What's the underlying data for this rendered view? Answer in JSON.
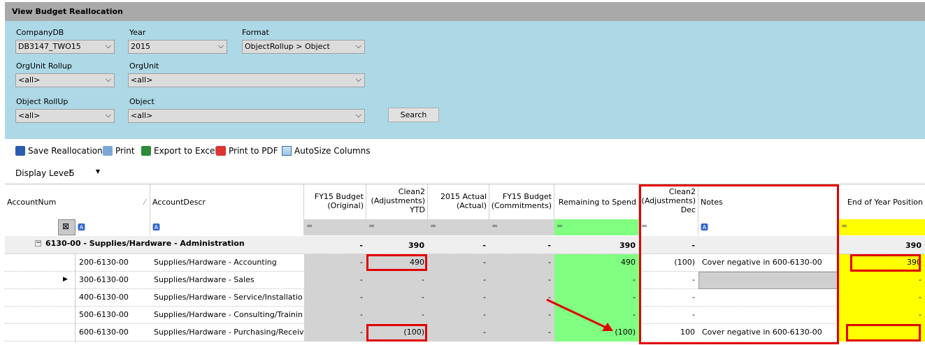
{
  "window": {
    "title": "View Budget Reallocation"
  },
  "filters": {
    "companydb": {
      "label": "CompanyDB",
      "value": "DB3147_TWO15"
    },
    "year": {
      "label": "Year",
      "value": "2015"
    },
    "format": {
      "label": "Format",
      "value": "ObjectRollup > Object"
    },
    "orgunit_rollup": {
      "label": "OrgUnit Rollup",
      "value": "<all>"
    },
    "orgunit": {
      "label": "OrgUnit",
      "value": "<all>"
    },
    "object_rollup": {
      "label": "Object RollUp",
      "value": "<all>"
    },
    "object": {
      "label": "Object",
      "value": "<all>"
    },
    "search_label": "Search"
  },
  "toolbar": {
    "save": "Save Reallocation",
    "print": "Print",
    "export": "Export to Excel",
    "pdf": "Print to PDF",
    "autosize": "AutoSize Columns"
  },
  "display_level": {
    "label": "Display Level",
    "value": "5"
  },
  "columns": {
    "accountnum": "AccountNum",
    "accountdescr": "AccountDescr",
    "fy15_original": "FY15 Budget (Original)",
    "clean2_ytd": "Clean2 (Adjustments) YTD",
    "actual_2015": "2015 Actual (Actual)",
    "fy15_commit": "FY15 Budget (Commitments)",
    "remaining": "Remaining to Spend",
    "clean2_dec": "Clean2 (Adjustments) Dec",
    "notes": "Notes",
    "eoy": "End of Year Position"
  },
  "group": {
    "label": "6130-00 - Supplies/Hardware - Administration",
    "fy15_original": "-",
    "clean2_ytd": "390",
    "actual_2015": "-",
    "fy15_commit": "-",
    "remaining": "390",
    "clean2_dec": "-",
    "eoy": "390"
  },
  "rows": [
    {
      "account": "200-6130-00",
      "descr": "Supplies/Hardware - Accounting",
      "fy15_original": "-",
      "clean2_ytd": "490",
      "actual_2015": "-",
      "fy15_commit": "-",
      "remaining": "490",
      "clean2_dec": "(100)",
      "notes": "Cover negative in 600-6130-00",
      "eoy": "390"
    },
    {
      "account": "300-6130-00",
      "descr": "Supplies/Hardware - Sales",
      "fy15_original": "-",
      "clean2_ytd": "-",
      "actual_2015": "-",
      "fy15_commit": "-",
      "remaining": "-",
      "clean2_dec": "-",
      "notes": "",
      "eoy": "-"
    },
    {
      "account": "400-6130-00",
      "descr": "Supplies/Hardware - Service/Installatio",
      "fy15_original": "-",
      "clean2_ytd": "-",
      "actual_2015": "-",
      "fy15_commit": "-",
      "remaining": "-",
      "clean2_dec": "-",
      "notes": "",
      "eoy": "-"
    },
    {
      "account": "500-6130-00",
      "descr": "Supplies/Hardware - Consulting/Trainin",
      "fy15_original": "-",
      "clean2_ytd": "-",
      "actual_2015": "-",
      "fy15_commit": "-",
      "remaining": "-",
      "clean2_dec": "-",
      "notes": "",
      "eoy": "-"
    },
    {
      "account": "600-6130-00",
      "descr": "Supplies/Hardware - Purchasing/Receiv",
      "fy15_original": "-",
      "clean2_ytd": "(100)",
      "actual_2015": "-",
      "fy15_commit": "-",
      "remaining": "(100)",
      "clean2_dec": "100",
      "notes": "Cover negative in 600-6130-00",
      "eoy": "-"
    }
  ],
  "colors": {
    "filter_bg": "#add8e6",
    "green": "#80ff80",
    "yellow": "#ffff00",
    "annotation_red": "#e00000"
  }
}
